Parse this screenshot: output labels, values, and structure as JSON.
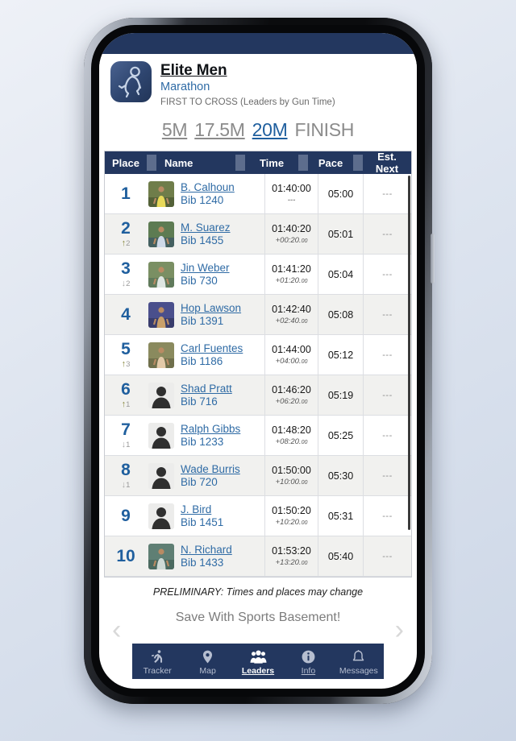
{
  "header": {
    "race_title": "Elite Men",
    "race_subtitle": "Marathon",
    "race_note": "FIRST TO CROSS (Leaders by Gun Time)",
    "logo_icon": "runner-logo-icon"
  },
  "split_tabs": [
    {
      "label": "5M",
      "active": false,
      "underline": true
    },
    {
      "label": "17.5M",
      "active": false,
      "underline": true
    },
    {
      "label": "20M",
      "active": true,
      "underline": true
    },
    {
      "label": "FINISH",
      "active": false,
      "underline": false
    }
  ],
  "table": {
    "columns": [
      "Place",
      "Name",
      "Time",
      "Pace",
      "Est. Next"
    ],
    "rows": [
      {
        "place": "1",
        "delta_dir": "",
        "delta_num": "",
        "name": "B. Calhoun",
        "bib": "Bib 1240",
        "avatar": "photo-yellow",
        "time": "01:40:00",
        "diff": "---",
        "diff_frac": "",
        "pace": "05:00",
        "est_next": "---"
      },
      {
        "place": "2",
        "delta_dir": "up",
        "delta_num": "2",
        "name": "M. Suarez",
        "bib": "Bib 1455",
        "avatar": "photo-blue",
        "time": "01:40:20",
        "diff": "+00:20.",
        "diff_frac": "00",
        "pace": "05:01",
        "est_next": "---"
      },
      {
        "place": "3",
        "delta_dir": "down",
        "delta_num": "2",
        "name": "Jin Weber",
        "bib": "Bib 730",
        "avatar": "photo-green",
        "time": "01:41:20",
        "diff": "+01:20.",
        "diff_frac": "00",
        "pace": "05:04",
        "est_next": "---"
      },
      {
        "place": "4",
        "delta_dir": "",
        "delta_num": "",
        "name": "Hop Lawson",
        "bib": "Bib 1391",
        "avatar": "photo-purple",
        "time": "01:42:40",
        "diff": "+02:40.",
        "diff_frac": "00",
        "pace": "05:08",
        "est_next": "---"
      },
      {
        "place": "5",
        "delta_dir": "up",
        "delta_num": "3",
        "name": "Carl Fuentes",
        "bib": "Bib 1186",
        "avatar": "photo-tan",
        "time": "01:44:00",
        "diff": "+04:00.",
        "diff_frac": "00",
        "pace": "05:12",
        "est_next": "---"
      },
      {
        "place": "6",
        "delta_dir": "up",
        "delta_num": "1",
        "name": "Shad Pratt",
        "bib": "Bib 716",
        "avatar": "silhouette",
        "time": "01:46:20",
        "diff": "+06:20.",
        "diff_frac": "00",
        "pace": "05:19",
        "est_next": "---"
      },
      {
        "place": "7",
        "delta_dir": "down",
        "delta_num": "1",
        "name": "Ralph Gibbs",
        "bib": "Bib 1233",
        "avatar": "silhouette",
        "time": "01:48:20",
        "diff": "+08:20.",
        "diff_frac": "00",
        "pace": "05:25",
        "est_next": "---"
      },
      {
        "place": "8",
        "delta_dir": "down",
        "delta_num": "1",
        "name": "Wade Burris",
        "bib": "Bib 720",
        "avatar": "silhouette",
        "time": "01:50:00",
        "diff": "+10:00.",
        "diff_frac": "00",
        "pace": "05:30",
        "est_next": "---"
      },
      {
        "place": "9",
        "delta_dir": "",
        "delta_num": "",
        "name": "J. Bird",
        "bib": "Bib 1451",
        "avatar": "silhouette",
        "time": "01:50:20",
        "diff": "+10:20.",
        "diff_frac": "00",
        "pace": "05:31",
        "est_next": "---"
      },
      {
        "place": "10",
        "delta_dir": "",
        "delta_num": "",
        "name": "N. Richard",
        "bib": "Bib 1433",
        "avatar": "photo-teal",
        "time": "01:53:20",
        "diff": "+13:20.",
        "diff_frac": "00",
        "pace": "05:40",
        "est_next": "---"
      }
    ]
  },
  "prelim_note": "PRELIMINARY: Times and places may change",
  "promo": {
    "text": "Save With Sports Basement!",
    "prev_icon": "chevron-left-icon",
    "next_icon": "chevron-right-icon"
  },
  "bottom_nav": [
    {
      "label": "Tracker",
      "icon": "runner-icon",
      "active": false
    },
    {
      "label": "Map",
      "icon": "map-pin-icon",
      "active": false
    },
    {
      "label": "Leaders",
      "icon": "people-group-icon",
      "active": true
    },
    {
      "label": "Info",
      "icon": "info-circle-icon",
      "active": false
    },
    {
      "label": "Messages",
      "icon": "bell-icon",
      "active": false
    }
  ],
  "colors": {
    "navy": "#23375f",
    "link_blue": "#2f6ba5",
    "place_blue": "#1f5f9e",
    "up_arrow": "#87873c",
    "down_arrow": "#a9a9a9"
  }
}
